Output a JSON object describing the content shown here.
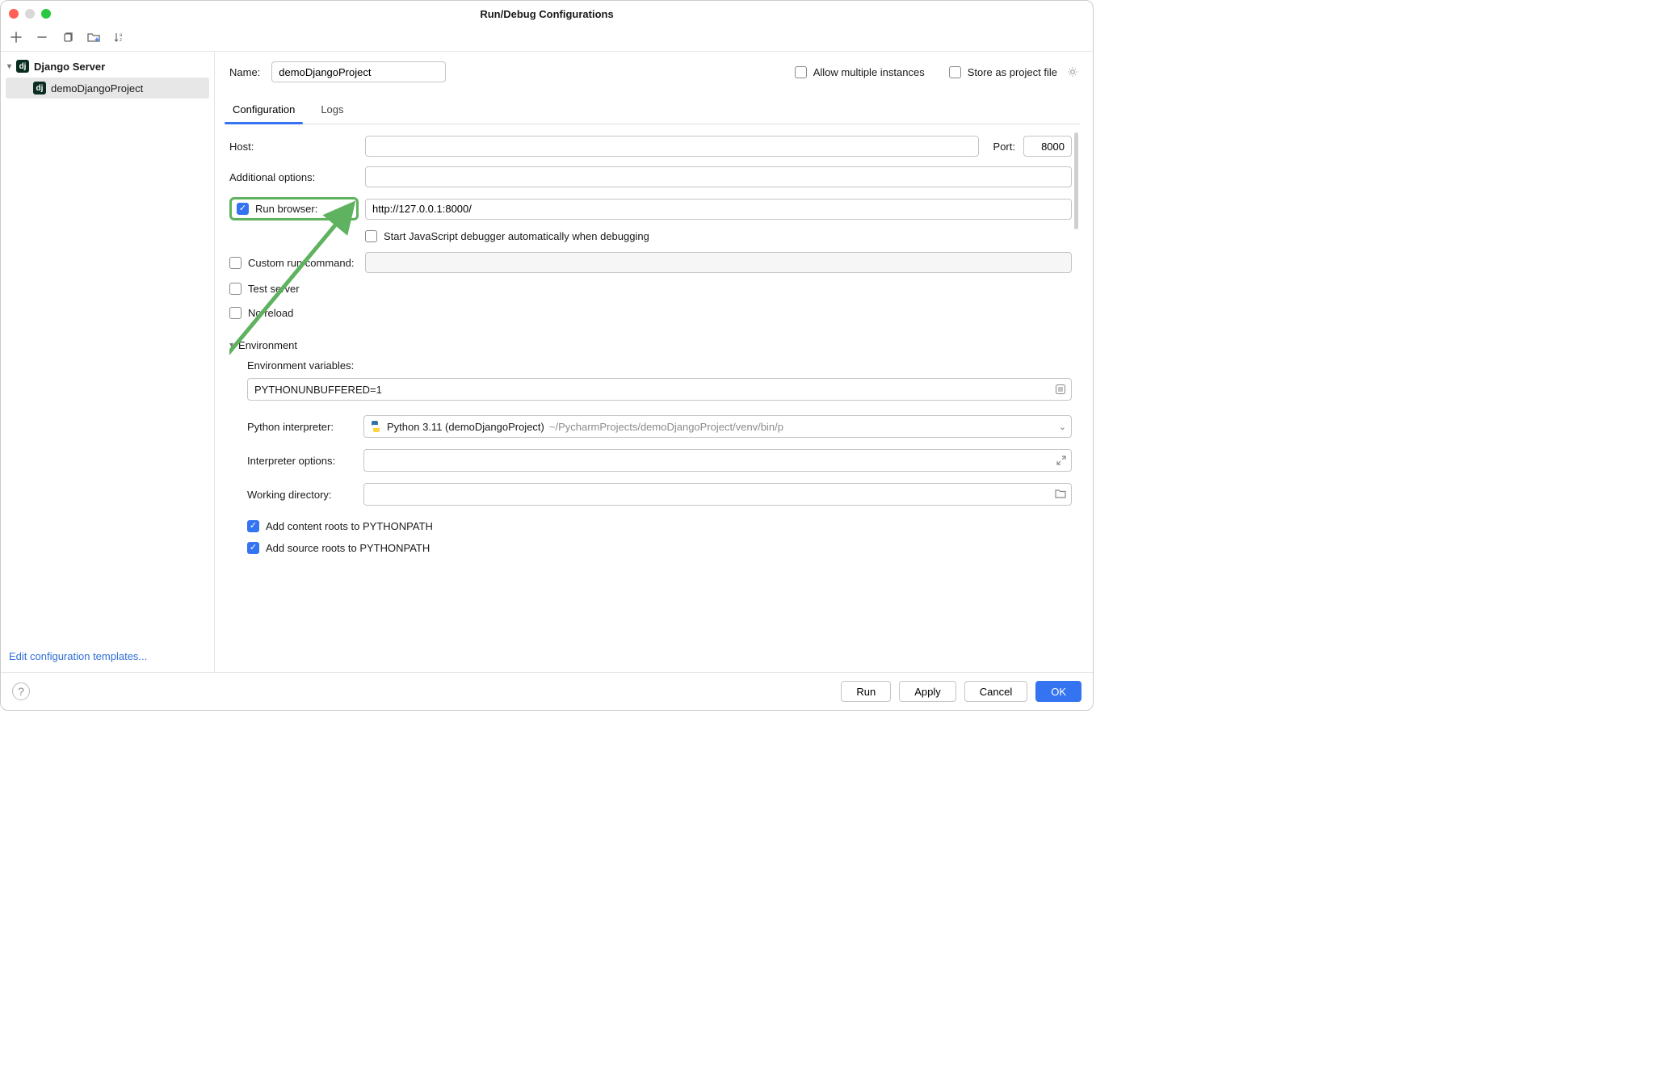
{
  "window": {
    "title": "Run/Debug Configurations"
  },
  "sidebar": {
    "group_label": "Django Server",
    "item_label": "demoDjangoProject",
    "edit_templates": "Edit configuration templates..."
  },
  "name": {
    "label": "Name:",
    "value": "demoDjangoProject"
  },
  "allow_multiple": {
    "label": "Allow multiple instances",
    "checked": false
  },
  "store_as_project": {
    "label": "Store as project file",
    "checked": false
  },
  "tabs": {
    "configuration": "Configuration",
    "logs": "Logs"
  },
  "form": {
    "host_label": "Host:",
    "host_value": "",
    "port_label": "Port:",
    "port_value": "8000",
    "additional_options_label": "Additional options:",
    "additional_options_value": "",
    "run_browser_label": "Run browser:",
    "run_browser_checked": true,
    "run_browser_url": "http://127.0.0.1:8000/",
    "start_js_debugger": {
      "label": "Start JavaScript debugger automatically when debugging",
      "checked": false
    },
    "custom_run_command": {
      "label": "Custom run command:",
      "checked": false,
      "value": ""
    },
    "test_server": {
      "label": "Test server",
      "checked": false
    },
    "no_reload": {
      "label": "No reload",
      "checked": false
    },
    "env_header": "Environment",
    "env_vars_label": "Environment variables:",
    "env_vars_value": "PYTHONUNBUFFERED=1",
    "py_interp_label": "Python interpreter:",
    "py_interp_name": "Python 3.11 (demoDjangoProject)",
    "py_interp_path": "~/PycharmProjects/demoDjangoProject/venv/bin/p",
    "interp_options_label": "Interpreter options:",
    "interp_options_value": "",
    "working_dir_label": "Working directory:",
    "working_dir_value": "",
    "add_content_roots": {
      "label": "Add content roots to PYTHONPATH",
      "checked": true
    },
    "add_source_roots": {
      "label": "Add source roots to PYTHONPATH",
      "checked": true
    }
  },
  "buttons": {
    "run": "Run",
    "apply": "Apply",
    "cancel": "Cancel",
    "ok": "OK"
  }
}
